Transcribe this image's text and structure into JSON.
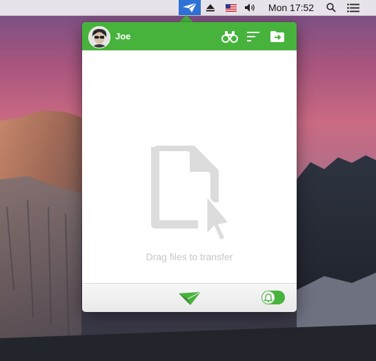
{
  "menubar": {
    "app_icon": "paper-plane-icon",
    "eject_icon": "eject-icon",
    "flag_icon": "us-flag-icon",
    "volume_icon": "volume-icon",
    "clock": "Mon 17:52",
    "search_icon": "search-icon",
    "list_icon": "list-icon"
  },
  "popover": {
    "user": {
      "name": "Joe",
      "avatar_icon": "user-avatar"
    },
    "header_buttons": [
      "binoculars-icon",
      "sort-icon",
      "folder-icon"
    ],
    "drop_zone": {
      "icon": "file-drag-icon",
      "text": "Drag files to transfer"
    },
    "footer": {
      "send_icon": "paper-plane-icon",
      "notifications_enabled": true,
      "toggle_icon": "bell-icon"
    }
  },
  "colors": {
    "accent": "#47b33c",
    "menubar_highlight": "#2e72d6"
  }
}
